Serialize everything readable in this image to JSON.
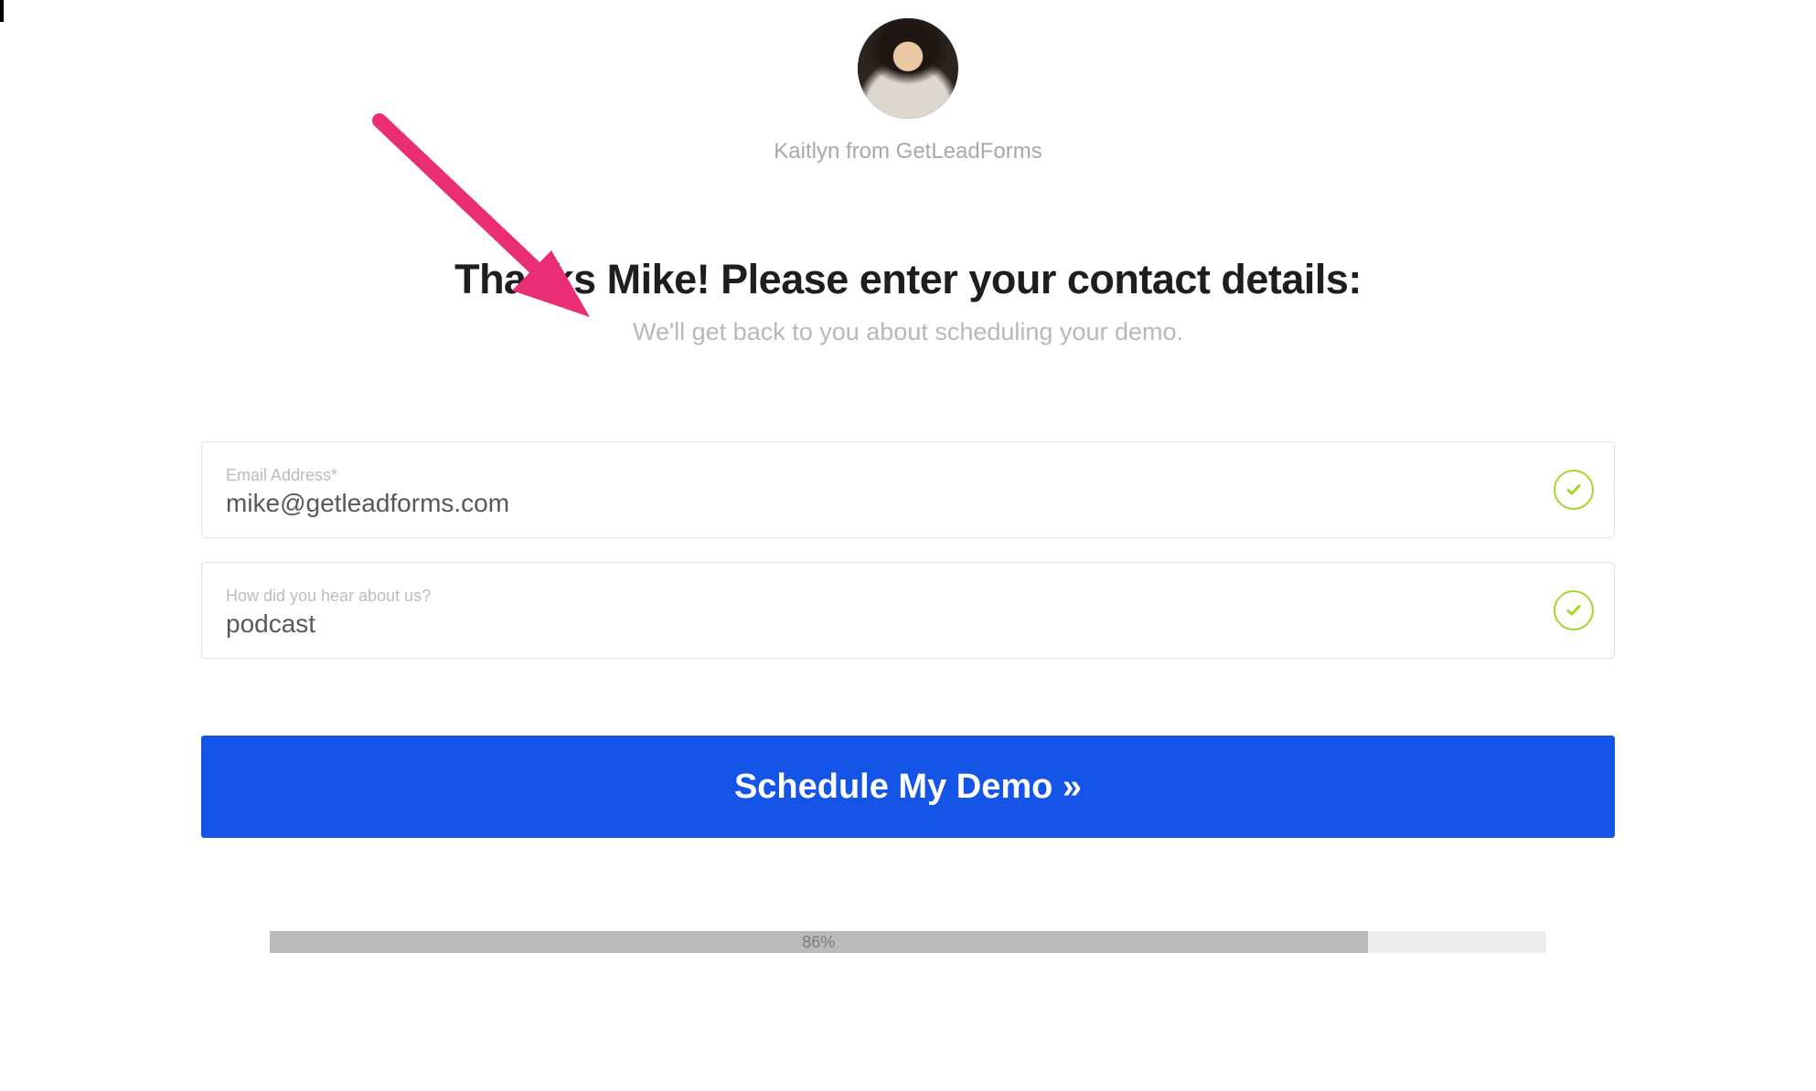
{
  "presenter": {
    "label": "Kaitlyn from GetLeadForms"
  },
  "heading": {
    "title": "Thanks Mike! Please enter your contact details:",
    "subtitle": "We'll get back to you about scheduling your demo."
  },
  "form": {
    "email": {
      "label": "Email Address*",
      "value": "mike@getleadforms.com",
      "valid": true
    },
    "source": {
      "label": "How did you hear about us?",
      "value": "podcast",
      "valid": true
    },
    "submit_label": "Schedule My Demo »"
  },
  "progress": {
    "percent": 86,
    "label": "86%"
  },
  "colors": {
    "primary_button": "#1454e6",
    "valid_ring": "#a3d629",
    "annotation_arrow": "#ea2e74"
  }
}
